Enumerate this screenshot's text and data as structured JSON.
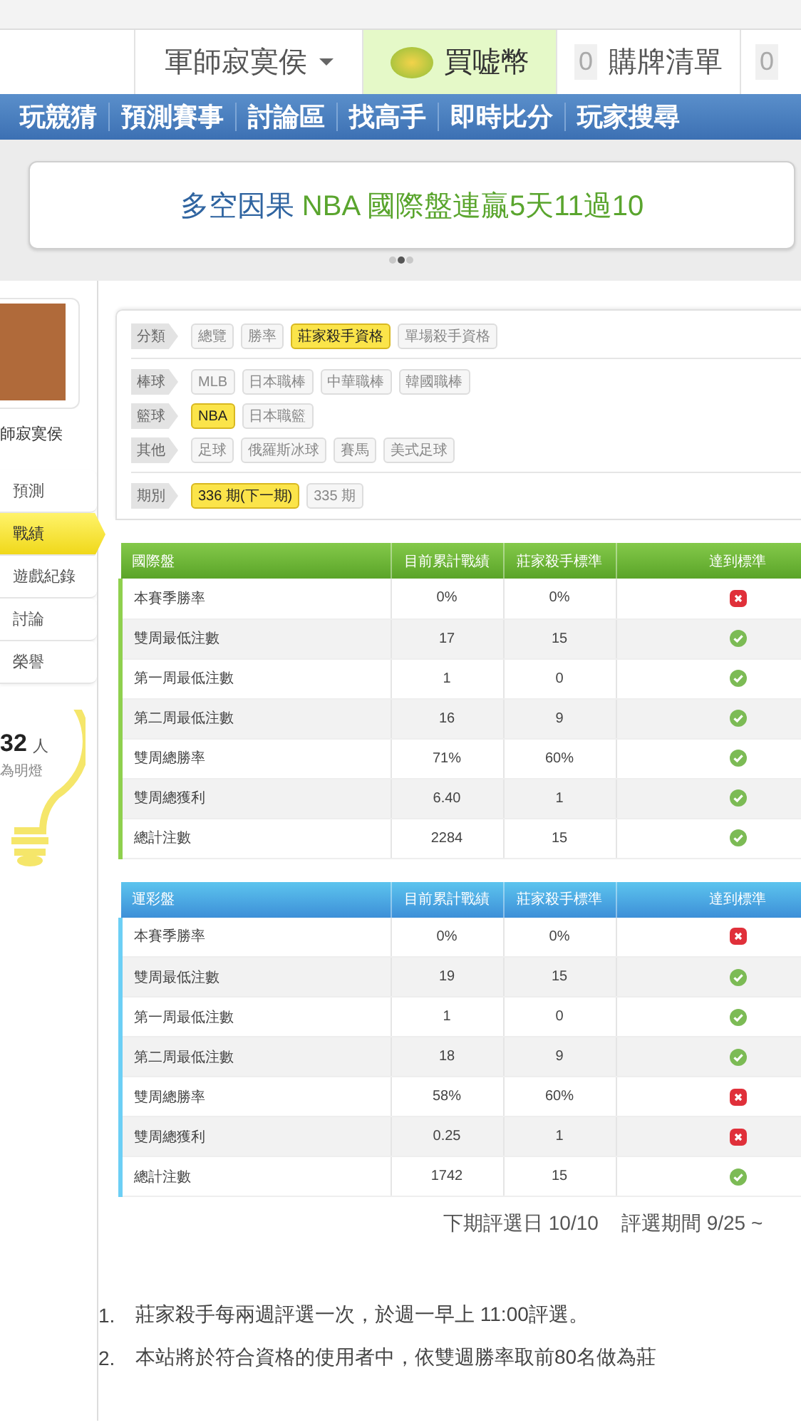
{
  "header": {
    "user_menu": "軍師寂寞侯",
    "buy_coins": "買嘘幣",
    "cart_count": "0",
    "cart": "購牌清單",
    "next_count": "0"
  },
  "nav": [
    "玩競猜",
    "預測賽事",
    "討論區",
    "找高手",
    "即時比分",
    "玩家搜尋"
  ],
  "banner": {
    "prefix": "多空因果",
    "headline": "NBA 國際盤連贏5天11過10",
    "dots": [
      {
        "selected": false
      },
      {
        "selected": true
      },
      {
        "selected": false
      }
    ]
  },
  "sidebar": {
    "user_name": "師寂寞侯",
    "menu": [
      {
        "label": "預測",
        "selected": false
      },
      {
        "label": "戰績",
        "selected": true
      },
      {
        "label": "遊戲紀錄",
        "selected": false
      },
      {
        "label": "討論",
        "selected": false
      },
      {
        "label": "榮譽",
        "selected": false
      }
    ],
    "count": "32",
    "count_unit": "人",
    "count_caption": "為明燈"
  },
  "filters": [
    {
      "label": "分類",
      "chips": [
        {
          "text": "總覽",
          "selected": false
        },
        {
          "text": "勝率",
          "selected": false
        },
        {
          "text": "莊家殺手資格",
          "selected": true
        },
        {
          "text": "單場殺手資格",
          "selected": false
        }
      ],
      "divider_after": true
    },
    {
      "label": "棒球",
      "chips": [
        {
          "text": "MLB",
          "selected": false
        },
        {
          "text": "日本職棒",
          "selected": false
        },
        {
          "text": "中華職棒",
          "selected": false
        },
        {
          "text": "韓國職棒",
          "selected": false
        }
      ],
      "divider_after": false
    },
    {
      "label": "籃球",
      "chips": [
        {
          "text": "NBA",
          "selected": true
        },
        {
          "text": "日本職籃",
          "selected": false
        }
      ],
      "divider_after": false
    },
    {
      "label": "其他",
      "chips": [
        {
          "text": "足球",
          "selected": false
        },
        {
          "text": "俄羅斯冰球",
          "selected": false
        },
        {
          "text": "賽馬",
          "selected": false
        },
        {
          "text": "美式足球",
          "selected": false
        }
      ],
      "divider_after": true
    },
    {
      "label": "期別",
      "chips": [
        {
          "text": "336 期(下一期)",
          "selected": true
        },
        {
          "text": "335 期",
          "selected": false
        }
      ],
      "divider_after": false
    }
  ],
  "tables": [
    {
      "kind": "international",
      "columns": [
        "國際盤",
        "目前累計戰績",
        "莊家殺手標準",
        "達到標準"
      ],
      "rows": [
        {
          "name": "本賽季勝率",
          "current": "0%",
          "standard": "0%",
          "met": false
        },
        {
          "name": "雙周最低注數",
          "current": "17",
          "standard": "15",
          "met": true
        },
        {
          "name": "第一周最低注數",
          "current": "1",
          "standard": "0",
          "met": true
        },
        {
          "name": "第二周最低注數",
          "current": "16",
          "standard": "9",
          "met": true
        },
        {
          "name": "雙周總勝率",
          "current": "71%",
          "standard": "60%",
          "met": true
        },
        {
          "name": "雙周總獲利",
          "current": "6.40",
          "standard": "1",
          "met": true
        },
        {
          "name": "總計注數",
          "current": "2284",
          "standard": "15",
          "met": true
        }
      ]
    },
    {
      "kind": "lottery",
      "columns": [
        "運彩盤",
        "目前累計戰績",
        "莊家殺手標準",
        "達到標準"
      ],
      "rows": [
        {
          "name": "本賽季勝率",
          "current": "0%",
          "standard": "0%",
          "met": false
        },
        {
          "name": "雙周最低注數",
          "current": "19",
          "standard": "15",
          "met": true
        },
        {
          "name": "第一周最低注數",
          "current": "1",
          "standard": "0",
          "met": true
        },
        {
          "name": "第二周最低注數",
          "current": "18",
          "standard": "9",
          "met": true
        },
        {
          "name": "雙周總勝率",
          "current": "58%",
          "standard": "60%",
          "met": false
        },
        {
          "name": "雙周總獲利",
          "current": "0.25",
          "standard": "1",
          "met": false
        },
        {
          "name": "總計注數",
          "current": "1742",
          "standard": "15",
          "met": true
        }
      ]
    }
  ],
  "schedule": {
    "next_date": "下期評選日 10/10",
    "period": "評選期間 9/25 ~"
  },
  "rules": [
    {
      "number": "1.",
      "text": "莊家殺手每兩週評選一次，於週一早上 11:00評選。"
    },
    {
      "number": "2.",
      "text": "本站將於符合資格的使用者中，依雙週勝率取前80名做為莊"
    }
  ]
}
